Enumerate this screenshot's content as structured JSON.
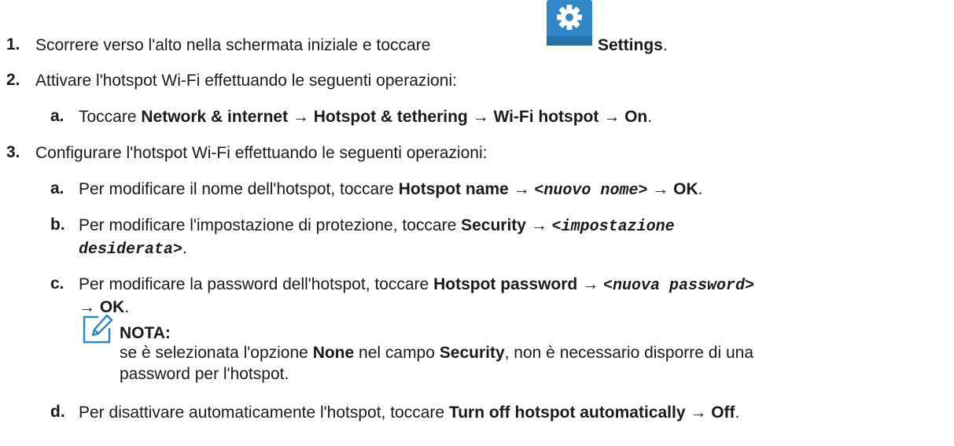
{
  "steps": [
    {
      "num": "1.",
      "pre": "Scorrere verso l'alto nella schermata iniziale e toccare",
      "icon": "settings-gear-icon",
      "post": "Settings",
      "end": "."
    },
    {
      "num": "2.",
      "text": "Attivare l'hotspot Wi-Fi effettuando le seguenti operazioni:",
      "substeps": [
        {
          "letter": "a.",
          "pre": "Toccare",
          "path": [
            "Network & internet",
            "Hotspot & tethering",
            "Wi-Fi hotspot",
            "On"
          ]
        }
      ]
    },
    {
      "num": "3.",
      "text": "Configurare l'hotspot Wi-Fi effettuando le seguenti operazioni:",
      "substeps": [
        {
          "letter": "a.",
          "pre": "Per modificare il nome dell'hotspot, toccare",
          "b1": "Hotspot name",
          "var": "<nuovo nome>",
          "b2": "OK"
        },
        {
          "letter": "b.",
          "pre": "Per modificare l'impostazione di protezione, toccare",
          "b1": "Security",
          "var1": "<impostazione",
          "var2": "desiderata>"
        },
        {
          "letter": "c.",
          "pre": "Per modificare la password dell'hotspot, toccare",
          "b1": "Hotspot password",
          "var": "<nuova password>",
          "b2": "OK"
        },
        {
          "letter": "d.",
          "pre": "Per disattivare automaticamente l'hotspot, toccare",
          "b1": "Turn off hotspot automatically",
          "b2": "Off"
        }
      ]
    }
  ],
  "note": {
    "title": "NOTA:",
    "pre": "se è selezionata l'opzione",
    "b1": "None",
    "mid": "nel campo",
    "b2": "Security",
    "post": ", non è necessario disporre di una",
    "line2": "password per l'hotspot.",
    "icon": "note-pencil-icon"
  },
  "arrow": "→",
  "colors": {
    "text": "#1a1a1a",
    "icon_blue": "#2f86c8",
    "note_icon": "#2f86c8"
  }
}
